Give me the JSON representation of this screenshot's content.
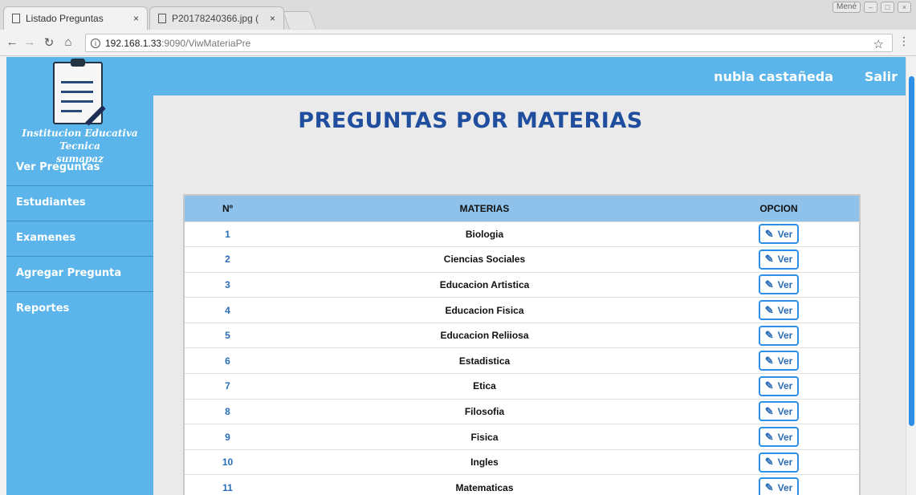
{
  "browser": {
    "tabs": [
      {
        "label": "Listado Preguntas",
        "close": "×"
      },
      {
        "label": "P20178240366.jpg (",
        "close": "×"
      }
    ],
    "window_pill": "Mené",
    "url_host": "192.168.1.33",
    "url_path": ":9090/ViwMateriaPre",
    "info_icon": "ⓘ",
    "star_icon": "☆",
    "menu_icon": "⋮"
  },
  "header": {
    "user": "nubla castañeda",
    "logout": "Salir"
  },
  "sidebar": {
    "school_name_line1": "Institucion Educativa Tecnica",
    "school_name_line2": "sumapaz",
    "items": [
      {
        "label": "Ver Preguntas"
      },
      {
        "label": "Estudiantes"
      },
      {
        "label": "Examenes"
      },
      {
        "label": "Agregar Pregunta"
      },
      {
        "label": "Reportes"
      }
    ]
  },
  "main": {
    "title": "PREGUNTAS POR MATERIAS",
    "table": {
      "headers": [
        "Nº",
        "MATERIAS",
        "OPCION"
      ],
      "button_label": "Ver",
      "rows": [
        {
          "num": "1",
          "materia": "Biologia"
        },
        {
          "num": "2",
          "materia": "Ciencias Sociales"
        },
        {
          "num": "3",
          "materia": "Educacion Artistica"
        },
        {
          "num": "4",
          "materia": "Educacion Fisica"
        },
        {
          "num": "5",
          "materia": "Educacion Reliiosa"
        },
        {
          "num": "6",
          "materia": "Estadistica"
        },
        {
          "num": "7",
          "materia": "Etica"
        },
        {
          "num": "8",
          "materia": "Filosofia"
        },
        {
          "num": "9",
          "materia": "Fisica"
        },
        {
          "num": "10",
          "materia": "Ingles"
        },
        {
          "num": "11",
          "materia": "Matematicas"
        }
      ]
    }
  },
  "colors": {
    "accent": "#5bb5ea",
    "title": "#1f4e9e",
    "table_header": "#8ec2ea",
    "button_border": "#2e8fe6"
  }
}
